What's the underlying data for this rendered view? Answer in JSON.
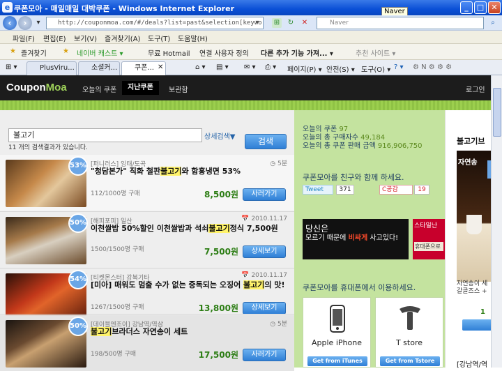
{
  "window": {
    "title": "쿠폰모아 - 매일매일 대박쿠폰 - Windows Internet Explorer",
    "tooltip": "Naver",
    "min": "_",
    "max": "□",
    "close": "✕"
  },
  "address": {
    "url": "http://couponmoa.com/#/deals?list=past&selection[keywords]=%E",
    "search_placeholder": "Naver"
  },
  "menu": [
    "파일(F)",
    "편집(E)",
    "보기(V)",
    "즐겨찾기(A)",
    "도구(T)",
    "도움말(H)"
  ],
  "favorites": {
    "label": "즐겨찾기",
    "items": [
      "네이버 캐스트 ▾",
      "무료 Hotmail",
      "연결 사용자 정의",
      "다른 추가 기능 가져... ▾",
      "추천 사이트 ▾"
    ]
  },
  "tabs": [
    {
      "label": "PlusViru..."
    },
    {
      "label": "소셜커..."
    },
    {
      "label": "쿠폰..."
    }
  ],
  "tab_tools": [
    "페이지(P) ▾",
    "안전(S) ▾",
    "도구(O) ▾"
  ],
  "site": {
    "logo_a": "Coupon",
    "logo_b": "Moa",
    "nav": [
      "오늘의 쿠폰",
      "지난쿠폰",
      "보관함"
    ],
    "login": "로그인"
  },
  "search": {
    "value": "불고기",
    "advanced": "상세검색▼",
    "button": "검색",
    "result_count": "11 개의 검색결과가 있습니다."
  },
  "deals": [
    {
      "badge": "53%",
      "meta": "[퍼니러스] 잉태/도곡",
      "when": "◷ 5분",
      "pre": "\"청담본가\" 직화 철판",
      "hl": "불고기",
      "post": "와 함흥냉면 53%",
      "sold": "112/1000명 구매",
      "price": "8,500원",
      "button": "사러가기"
    },
    {
      "badge": "50%",
      "meta": "[해피포피] 일산",
      "when": "📅 2010.11.17",
      "pre": "이천쌀밥 50%할인 이천쌀밥과 석쇠",
      "hl": "불고기",
      "post": "정식 7,500원",
      "sold": "1500/1500명 구매",
      "price": "7,500원",
      "button": "상세보기"
    },
    {
      "badge": "54%",
      "meta": "[티켓몬스터] 강북기타",
      "when": "📅 2010.11.17",
      "pre": "[미아] 매워도 멈출 수가 없는 중독되는 오징어 ",
      "hl": "불고기",
      "post": "의 맛!",
      "sold": "1267/1500명 구매",
      "price": "13,800원",
      "button": "상세보기"
    },
    {
      "badge": "50%",
      "meta": "[데이블엔조이] 강남역/역삼",
      "when": "◷ 5분",
      "pre": "",
      "hl": "불고기",
      "post": "브라더스 자연송이 세트",
      "sold": "198/500명 구매",
      "price": "17,500원",
      "button": "사러가기"
    }
  ],
  "stats": {
    "line1_label": "오늘의 쿠폰",
    "line1_value": "97",
    "line2_label": "오늘의 총 구매자수",
    "line2_value": "49,184",
    "line3_label": "오늘의 총 쿠폰 판매 금액",
    "line3_value": "916,906,750"
  },
  "social": {
    "invite": "쿠폰모아를 친구와 함께 하세요.",
    "tweet": "Tweet",
    "tweet_count": "371",
    "gong": "C공감",
    "gong_count": "19"
  },
  "ads": {
    "ad1_line1": "당신은",
    "ad1_line2a": "모르기 때문에 ",
    "ad1_line2b": "비싸게",
    "ad1_line2c": " 사고있다!",
    "ad2_line1": "스타일난",
    "ad2_line2": "휴대폰으로"
  },
  "mobile": {
    "title": "쿠폰모아를 휴대폰에서 이용하세요.",
    "apps": [
      {
        "label": "Apple iPhone",
        "button": "Get from iTunes"
      },
      {
        "label": "T store",
        "button": "Get from Tstore"
      }
    ]
  },
  "right": {
    "title": "불고기브",
    "img_text": "자연송",
    "text1": "자연송이 세",
    "text2": "갈골즈스 +",
    "price": "1",
    "footer": "[강남역/역"
  },
  "colors": {
    "accent_green": "#9ccf4e",
    "nav_bg": "#1c1c1c",
    "button_blue": "#2f7fd6",
    "price_green": "#2c7d14",
    "highlight": "#fff36a"
  }
}
